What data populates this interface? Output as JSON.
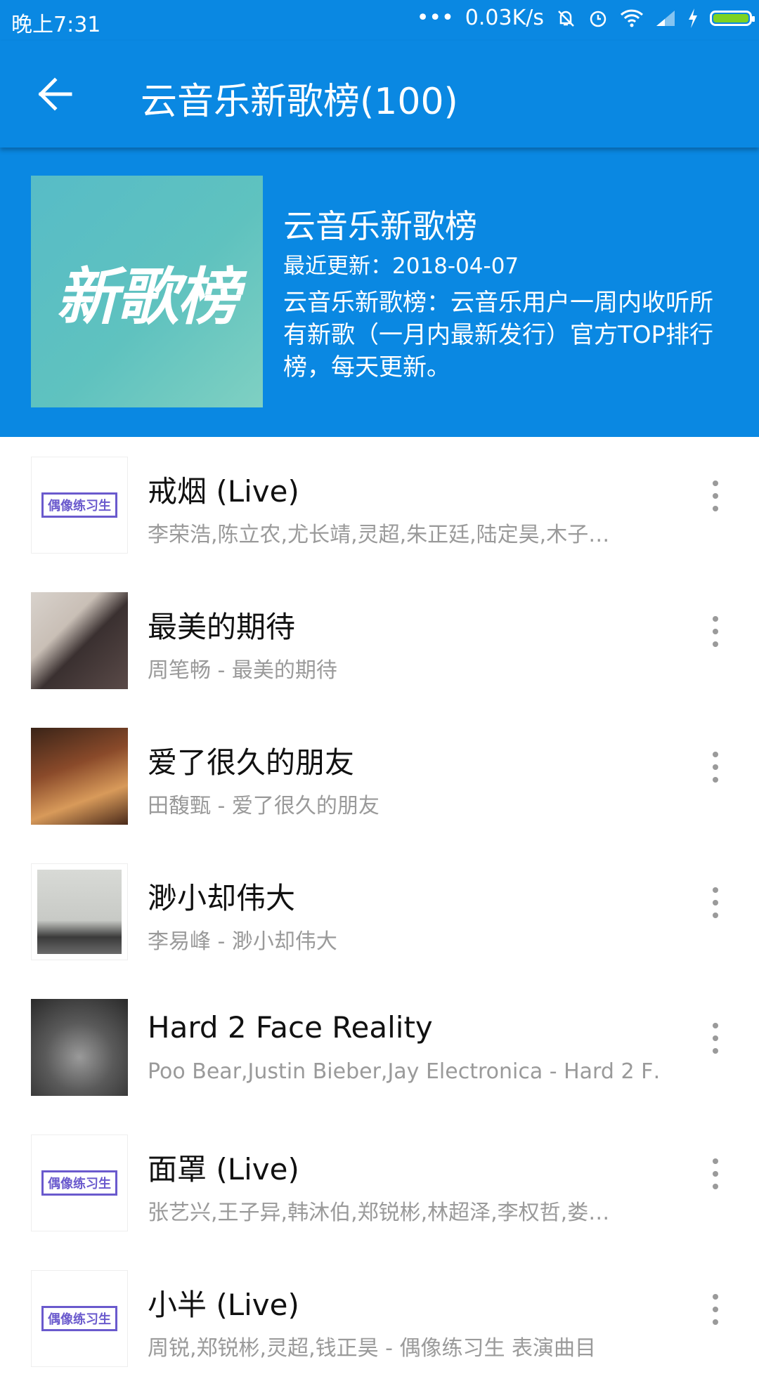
{
  "status_bar": {
    "time": "晚上7:31",
    "network_speed": "0.03K/s",
    "icons": [
      "dots-icon",
      "mute-icon",
      "alarm-icon",
      "wifi-icon",
      "signal-icon",
      "charging-icon",
      "battery-icon"
    ]
  },
  "app_bar": {
    "back_icon": "arrow-left-icon",
    "title": "云音乐新歌榜(100)"
  },
  "header": {
    "cover_text": "新歌榜",
    "title": "云音乐新歌榜",
    "updated": "最近更新：2018-04-07",
    "description": "云音乐新歌榜：云音乐用户一周内收听所有新歌（一月内最新发行）官方TOP排行榜，每天更新。"
  },
  "songs": [
    {
      "title": "戒烟 (Live)",
      "subtitle": "李荣浩,陈立农,尤长靖,灵超,朱正廷,陆定昊,木子…",
      "cover": "idol-producer"
    },
    {
      "title": "最美的期待",
      "subtitle": "周笔畅 - 最美的期待",
      "cover": "photo"
    },
    {
      "title": "爱了很久的朋友",
      "subtitle": "田馥甄 - 爱了很久的朋友",
      "cover": "photo"
    },
    {
      "title": "渺小却伟大",
      "subtitle": "李易峰 - 渺小却伟大",
      "cover": "photo"
    },
    {
      "title": "Hard 2 Face Reality",
      "subtitle": "Poo Bear,Justin Bieber,Jay Electronica - Hard 2 F…",
      "cover": "photo"
    },
    {
      "title": "面罩 (Live)",
      "subtitle": "张艺兴,王子异,韩沐伯,郑锐彬,林超泽,李权哲,娄…",
      "cover": "idol-producer"
    },
    {
      "title": "小半 (Live)",
      "subtitle": "周锐,郑锐彬,灵超,钱正昊 - 偶像练习生 表演曲目",
      "cover": "idol-producer"
    }
  ],
  "idol_logo_text": "偶像练习生",
  "colors": {
    "primary": "#0a88e2",
    "subtitle": "#9a9a9a"
  }
}
